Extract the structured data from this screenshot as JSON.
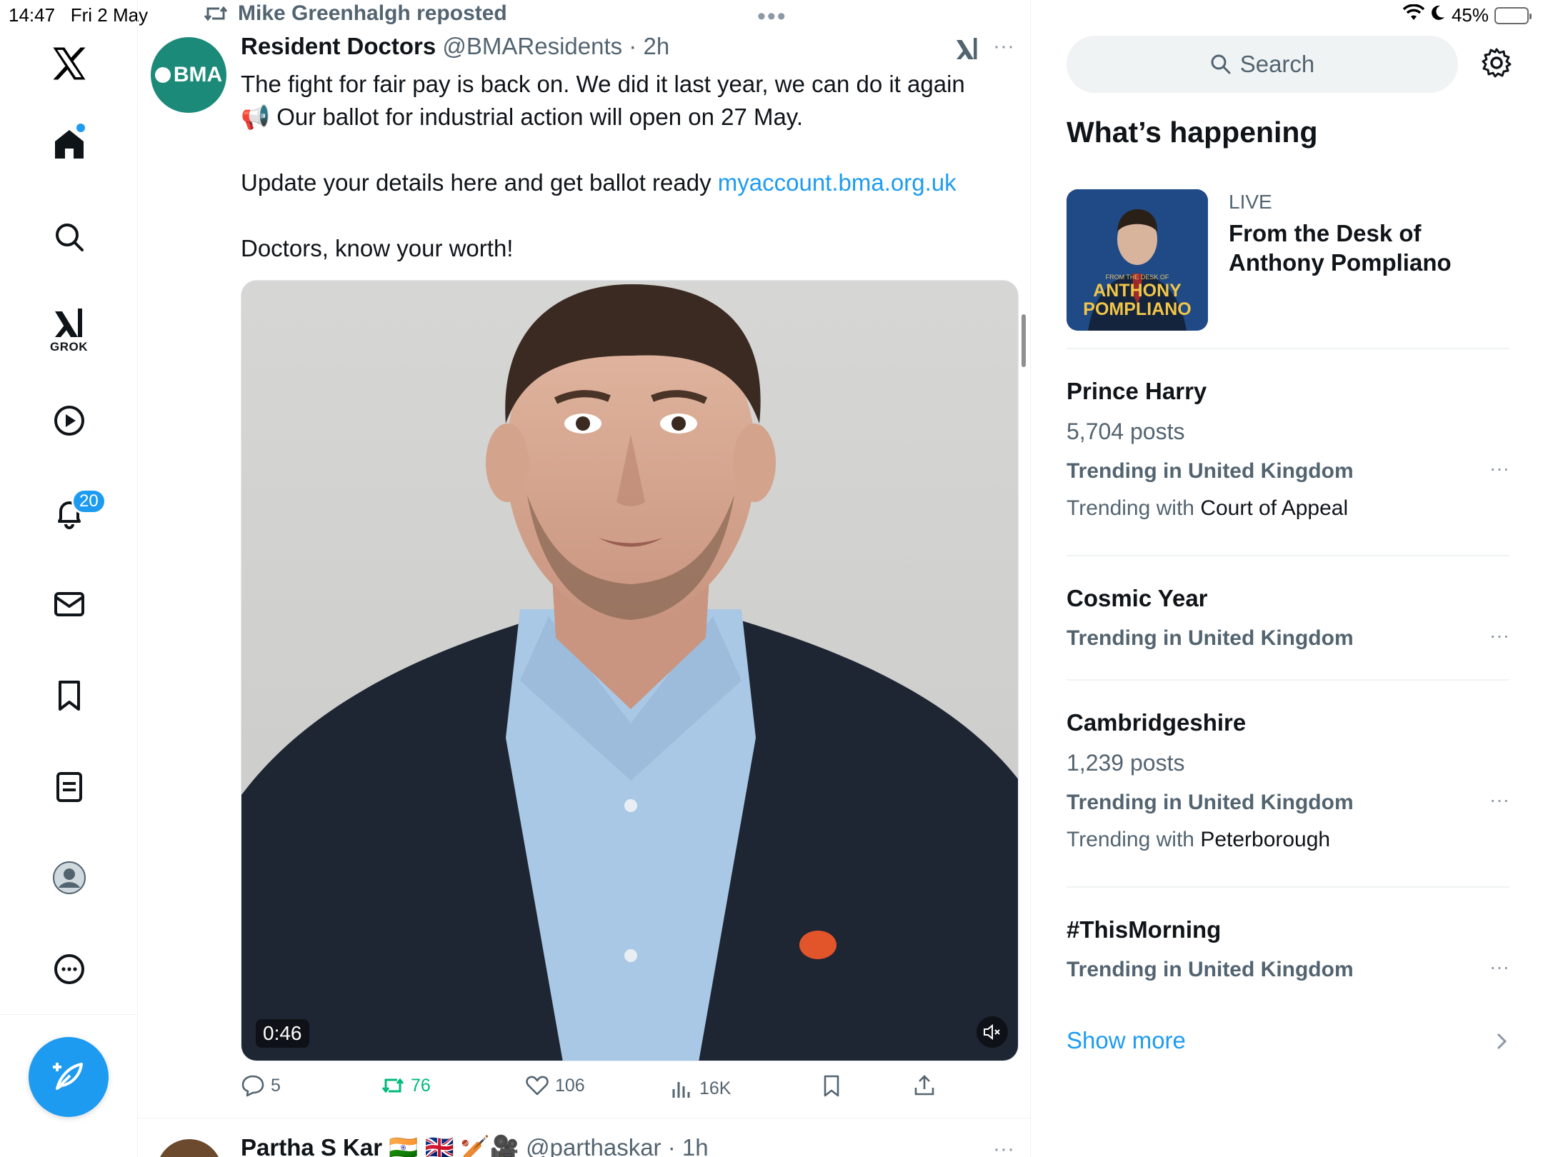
{
  "status_bar": {
    "time": "14:47",
    "date": "Fri 2 May",
    "battery": "45%",
    "battery_level": 0.45,
    "top_dots": "•••"
  },
  "nav": {
    "grok_label": "GROK",
    "notifications_badge": "20",
    "icons": [
      "x-logo-icon",
      "home-icon",
      "search-icon",
      "grok-icon",
      "video-icon",
      "bell-icon",
      "mail-icon",
      "bookmark-icon",
      "lists-icon",
      "profile-icon",
      "more-icon",
      "compose-icon"
    ]
  },
  "tweet": {
    "repost_by": "Mike Greenhalgh reposted",
    "avatar_text": "BMA",
    "name": "Resident Doctors",
    "meta": " @BMAResidents · 2h",
    "more": "···",
    "line1": "The fight for fair pay is back on. We did it last year, we can do it again",
    "line2_emoji": "📢",
    "line2": " Our ballot for industrial action will open on 27 May.",
    "line3": "Update your details here and get ballot ready ",
    "link": "myaccount.bma.org.uk",
    "line4": "Doctors, know your worth!",
    "video_duration": "0:46",
    "actions": {
      "replies": "5",
      "reposts": "76",
      "likes": "106",
      "views": "16K"
    }
  },
  "next_tweet": {
    "name": "Partha S Kar",
    "flags": " 🇮🇳 🇬🇧 🏏🎥 ",
    "meta": "@parthaskar · 1h",
    "more": "···"
  },
  "sidebar": {
    "search_placeholder": "Search",
    "whats_happening": "What’s happening",
    "live": {
      "label": "LIVE",
      "title": "From the Desk of Anthony Pompliano",
      "thumb_small": "FROM THE DESK OF",
      "thumb_line1": "ANTHONY",
      "thumb_line2": "POMPLIANO"
    },
    "trends": [
      {
        "name": "Prince Harry",
        "count": "5,704 posts",
        "context": "Trending in United Kingdom",
        "with_prefix": "Trending with ",
        "with": "Court of Appeal"
      },
      {
        "name": "Cosmic Year",
        "context": "Trending in United Kingdom"
      },
      {
        "name": "Cambridgeshire",
        "count": "1,239 posts",
        "context": "Trending in United Kingdom",
        "with_prefix": "Trending with ",
        "with": "Peterborough"
      },
      {
        "name": "#ThisMorning",
        "context": "Trending in United Kingdom"
      }
    ],
    "trend_more": "···",
    "show_more": "Show more"
  },
  "colors": {
    "accent": "#1d9bf0",
    "repost_green": "#00ba7c",
    "bma_teal": "#1b8a79",
    "muted": "#536471"
  }
}
